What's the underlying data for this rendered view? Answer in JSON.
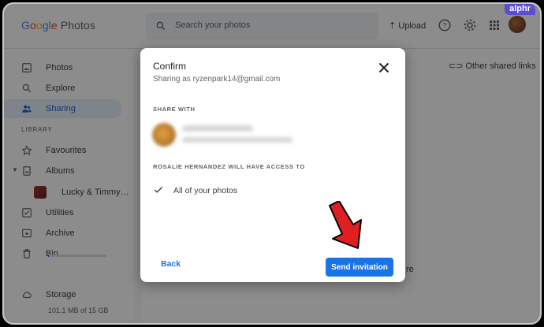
{
  "brand": {
    "logo_parts": [
      "G",
      "o",
      "o",
      "g",
      "l",
      "e"
    ],
    "product": "Photos",
    "watermark": "alphr"
  },
  "topbar": {
    "search_placeholder": "Search your photos",
    "upload_label": "Upload",
    "icons": [
      "search-icon",
      "upload-icon",
      "help-icon",
      "settings-icon",
      "apps-grid-icon",
      "account-avatar"
    ]
  },
  "sidebar": {
    "items": [
      {
        "label": "Photos",
        "icon": "photo-icon"
      },
      {
        "label": "Explore",
        "icon": "search-icon"
      },
      {
        "label": "Sharing",
        "icon": "people-icon",
        "active": true
      }
    ],
    "library_label": "LIBRARY",
    "library_items": [
      {
        "label": "Favourites",
        "icon": "star-icon"
      },
      {
        "label": "Albums",
        "icon": "album-icon"
      },
      {
        "label": "Lucky & Timmy…",
        "icon": "album-thumbnail"
      },
      {
        "label": "Utilities",
        "icon": "utilities-icon"
      },
      {
        "label": "Archive",
        "icon": "archive-icon"
      },
      {
        "label": "Bin",
        "icon": "trash-icon"
      }
    ],
    "storage": {
      "label": "Storage",
      "usage": "101.1 MB of 15 GB",
      "used_fraction": 0.007
    }
  },
  "main": {
    "other_shared_links": "Other shared links",
    "background_fragment": "re"
  },
  "dialog": {
    "title": "Confirm",
    "subtitle": "Sharing as ryzenpark14@gmail.com",
    "share_with_label": "SHARE WITH",
    "access_label": "ROSALIE HERNANDEZ WILL HAVE ACCESS TO",
    "access_item": "All of your photos",
    "back_label": "Back",
    "send_label": "Send invitation"
  },
  "colors": {
    "accent": "#1a73e8",
    "active_nav_bg": "#e8f0fe",
    "annotation_arrow": "#e02020",
    "watermark_bg": "#5b4bd8"
  }
}
